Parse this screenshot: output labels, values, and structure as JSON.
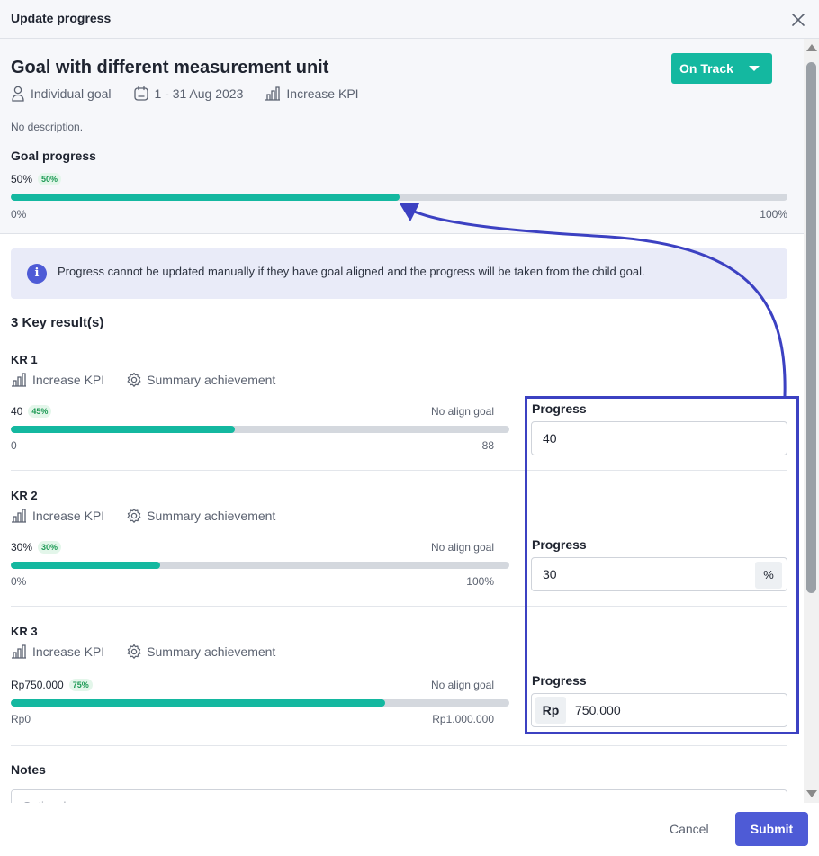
{
  "modal": {
    "title": "Update progress"
  },
  "goal": {
    "title": "Goal with different measurement unit",
    "owner": "Individual goal",
    "period": "1 - 31 Aug 2023",
    "type": "Increase KPI",
    "description": "No description.",
    "status": "On Track",
    "progress_label": "Goal progress",
    "value": "50%",
    "percent_badge": "50%",
    "progress_fraction": 0.5,
    "range_min": "0%",
    "range_max": "100%"
  },
  "info": {
    "text": "Progress cannot be updated manually if they have goal aligned and the progress will be taken from the child goal."
  },
  "key_results": {
    "count_label": "3 Key result(s)",
    "items": [
      {
        "name": "KR 1",
        "type": "Increase KPI",
        "summary": "Summary achievement",
        "value": "40",
        "badge": "45%",
        "fraction": 0.45,
        "align": "No align goal",
        "min": "0",
        "max": "88",
        "progress_label": "Progress",
        "input_value": "40",
        "prefix": "",
        "suffix": ""
      },
      {
        "name": "KR 2",
        "type": "Increase KPI",
        "summary": "Summary achievement",
        "value": "30%",
        "badge": "30%",
        "fraction": 0.3,
        "align": "No align goal",
        "min": "0%",
        "max": "100%",
        "progress_label": "Progress",
        "input_value": "30",
        "prefix": "",
        "suffix": "%"
      },
      {
        "name": "KR 3",
        "type": "Increase KPI",
        "summary": "Summary achievement",
        "value": "Rp750.000",
        "badge": "75%",
        "fraction": 0.75,
        "align": "No align goal",
        "min": "Rp0",
        "max": "Rp1.000.000",
        "progress_label": "Progress",
        "input_value": "750.000",
        "prefix": "Rp",
        "suffix": ""
      }
    ]
  },
  "notes": {
    "label": "Notes",
    "placeholder": "Optional"
  },
  "footer": {
    "cancel": "Cancel",
    "submit": "Submit"
  },
  "colors": {
    "accent": "#4e5bd6",
    "status": "#14b8a0",
    "annotation": "#3c41c2"
  },
  "icons": {
    "close": "close-icon",
    "owner": "person-icon",
    "period": "calendar-icon",
    "kpi": "bar-chart-icon",
    "summary": "gear-icon",
    "info": "info-icon"
  }
}
